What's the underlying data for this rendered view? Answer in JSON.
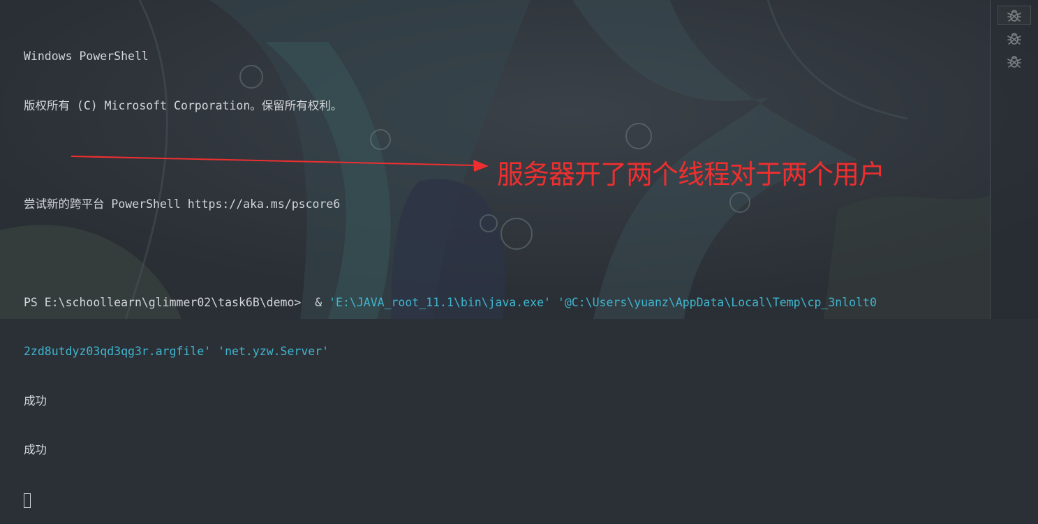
{
  "terminal": {
    "banner_title": "Windows PowerShell",
    "copyright": "版权所有 (C) Microsoft Corporation。保留所有权利。",
    "try_new": "尝试新的跨平台 PowerShell https://aka.ms/pscore6",
    "prompt": "PS E:\\schoollearn\\glimmer02\\task6B\\demo>  & ",
    "arg_java_exe": "'E:\\JAVA_root_11.1\\bin\\java.exe'",
    "arg_argfile_part1": "'@C:\\Users\\yuanz\\AppData\\Local\\Temp\\cp_3nlolt0",
    "arg_argfile_part2": "2zd8utdyz03qd3qg3r.argfile'",
    "arg_main_class": "'net.yzw.Server'",
    "output_lines": [
      "成功",
      "成功"
    ]
  },
  "annotation": {
    "text": "服务器开了两个线程对于两个用户",
    "color": "#ef2f2f"
  },
  "sessions": [
    {
      "icon": "bug-icon",
      "active": true
    },
    {
      "icon": "bug-icon",
      "active": false
    },
    {
      "icon": "bug-icon",
      "active": false
    }
  ],
  "colors": {
    "text": "#d3d6da",
    "string": "#3fb6cf",
    "background": "#2b3036"
  }
}
